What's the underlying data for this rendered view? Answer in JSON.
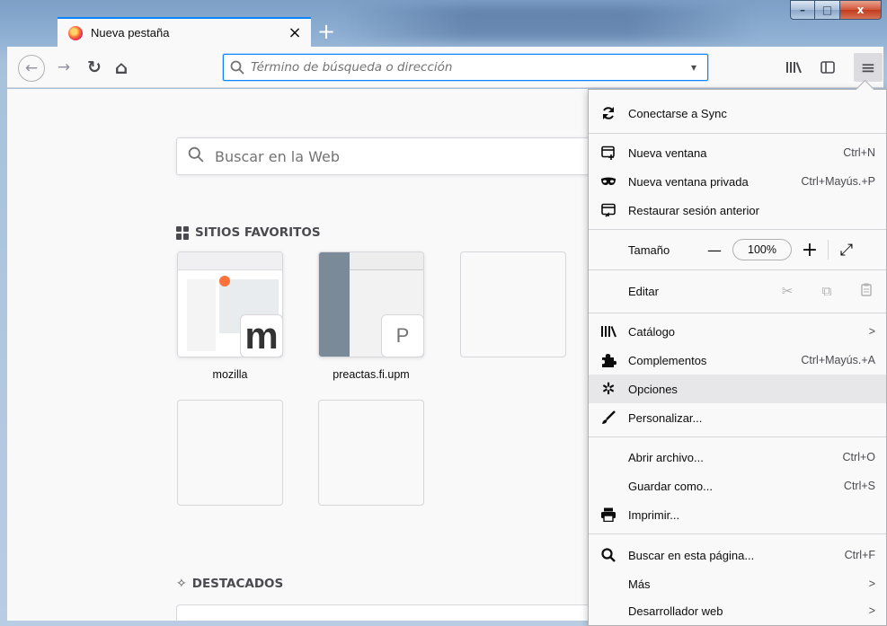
{
  "tab": {
    "title": "Nueva pestaña",
    "close": "×"
  },
  "tabbar": {
    "new_tab": "+"
  },
  "window": {
    "minimize": "–",
    "maximize": "□",
    "close": "x"
  },
  "navbar": {
    "back": "←",
    "forward": "→",
    "reload": "↻",
    "home": "⌂",
    "url_placeholder": "Término de búsqueda o dirección",
    "url_dropdown": "▾",
    "library": "⦀",
    "sidebar": "◫",
    "menu": "≡"
  },
  "newtab": {
    "search_placeholder": "Buscar en la Web",
    "top_sites_title": "SITIOS FAVORITOS",
    "highlights_title": "DESTACADOS",
    "top_sites": [
      {
        "label": "mozilla",
        "badge": "m"
      },
      {
        "label": "preactas.fi.upm",
        "badge": "P"
      }
    ]
  },
  "menu": {
    "sync": {
      "label": "Conectarse a Sync",
      "icon": "sync-icon"
    },
    "new_window": {
      "label": "Nueva ventana",
      "shortcut": "Ctrl+N"
    },
    "private_window": {
      "label": "Nueva ventana privada",
      "shortcut": "Ctrl+Mayús.+P"
    },
    "restore": {
      "label": "Restaurar sesión anterior"
    },
    "zoom": {
      "label": "Tamaño",
      "value": "100%",
      "minus": "—",
      "plus": "+",
      "fullscreen": "⤢"
    },
    "edit": {
      "label": "Editar",
      "cut": "✂",
      "copy": "⧉",
      "paste": "📋"
    },
    "library": {
      "label": "Catálogo",
      "arrow": ">"
    },
    "addons": {
      "label": "Complementos",
      "shortcut": "Ctrl+Mayús.+A"
    },
    "options": {
      "label": "Opciones"
    },
    "customize": {
      "label": "Personalizar..."
    },
    "open_file": {
      "label": "Abrir archivo...",
      "shortcut": "Ctrl+O"
    },
    "save_as": {
      "label": "Guardar como...",
      "shortcut": "Ctrl+S"
    },
    "print": {
      "label": "Imprimir..."
    },
    "find": {
      "label": "Buscar en esta página...",
      "shortcut": "Ctrl+F"
    },
    "more": {
      "label": "Más",
      "arrow": ">"
    },
    "webdev": {
      "label": "Desarrollador web",
      "arrow": ">"
    }
  }
}
